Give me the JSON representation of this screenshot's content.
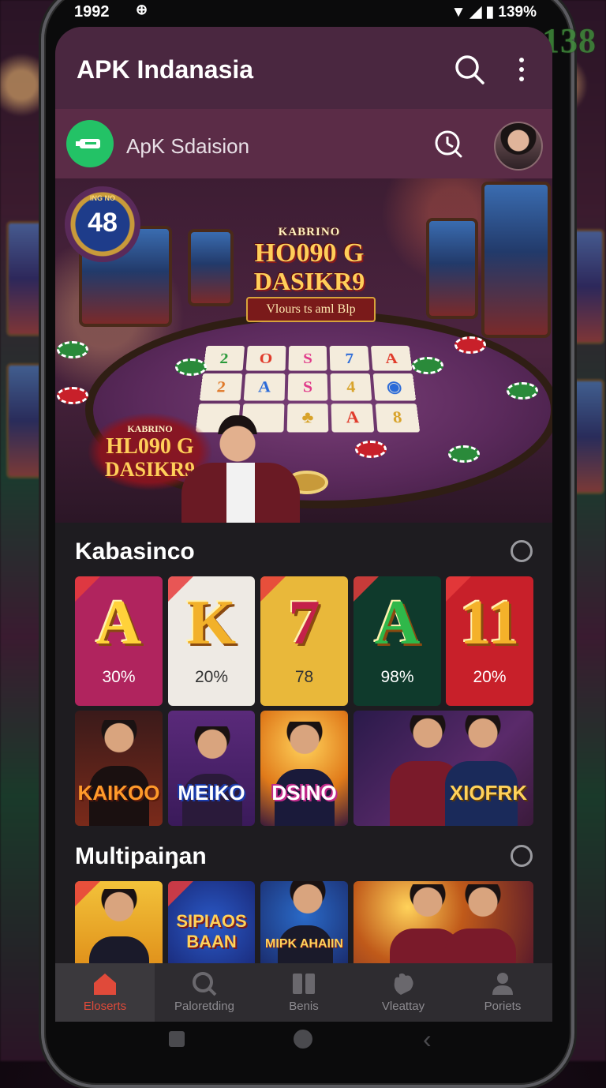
{
  "watermark": "KOKO138",
  "status": {
    "time": "1992",
    "battery": "139%"
  },
  "appbar": {
    "title": "APK Indanasia"
  },
  "subbar": {
    "label": "ApK Sdaision"
  },
  "banner": {
    "badge_number": "48",
    "badge_ring_text": "ING NO",
    "logo_top": "KABRINO",
    "logo_line2": "HO090 G",
    "logo_line3": "DASIKR9",
    "ribbon": "Vlours ts aml Blp",
    "logo_small_top": "KABRINO",
    "logo_small_line2": "HL090 G",
    "logo_small_line3": "DASIKR9",
    "cards": [
      "2",
      "O",
      "S",
      "7",
      "A",
      "2",
      "A",
      "S",
      "4",
      "",
      "",
      " ",
      "",
      "A",
      "8"
    ]
  },
  "section1": {
    "title": "Kabasinco",
    "tiles": [
      {
        "letter": "A",
        "pct": "30%",
        "bg": "#b0245e",
        "letter_color": "#ffd23a"
      },
      {
        "letter": "K",
        "pct": "20%",
        "bg": "#eeeae4",
        "letter_color": "#f2b12a"
      },
      {
        "letter": "7",
        "pct": "78",
        "bg": "#e9b83a",
        "letter_color": "#c4204a"
      },
      {
        "letter": "A",
        "pct": "98%",
        "bg": "#0f3a2c",
        "letter_color": "#2fb84a"
      },
      {
        "letter": "11",
        "pct": "20%",
        "bg": "#c8202a",
        "letter_color": "#f4b12a"
      }
    ],
    "promos": [
      {
        "label": "KAIKOO",
        "color": "#ff9a2a"
      },
      {
        "label": "MEIKO",
        "color": "#ffffff"
      },
      {
        "label": "DSINO",
        "color": "#ffffff"
      },
      {
        "label": "XIOFRK",
        "color": "#ffd25a"
      }
    ]
  },
  "section2": {
    "title": "Multipaiŋan",
    "promos": [
      {
        "label": ""
      },
      {
        "label": "SIPIAOS BAAN"
      },
      {
        "label": "MIPK AHAIIN"
      },
      {
        "label": ""
      }
    ]
  },
  "bottomnav": {
    "items": [
      {
        "label": "Eloserts"
      },
      {
        "label": "Paloretding"
      },
      {
        "label": "Benis"
      },
      {
        "label": "Vleattay"
      },
      {
        "label": "Poriets"
      }
    ]
  },
  "colors": {
    "appbar": "#4a2740",
    "subbar": "#5b2c47",
    "accent": "#e04a3a"
  }
}
